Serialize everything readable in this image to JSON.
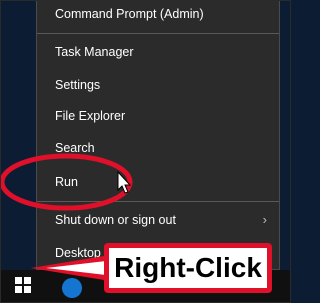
{
  "menu": {
    "items": [
      {
        "label": "Command Prompt (Admin)"
      },
      {
        "label": "Task Manager"
      },
      {
        "label": "Settings"
      },
      {
        "label": "File Explorer"
      },
      {
        "label": "Search"
      },
      {
        "label": "Run"
      },
      {
        "label": "Shut down or sign out"
      },
      {
        "label": "Desktop"
      }
    ]
  },
  "annotation": {
    "callout_label": "Right-Click",
    "highlight_color": "#e0102a"
  },
  "taskbar": {
    "start_icon": "windows-logo-icon",
    "pinned_app_icon": "edge-icon"
  },
  "colors": {
    "menu_bg": "#2b2b2b",
    "taskbar_bg": "#101010",
    "text": "#ffffff",
    "desktop_bg": "#0c1d33"
  }
}
